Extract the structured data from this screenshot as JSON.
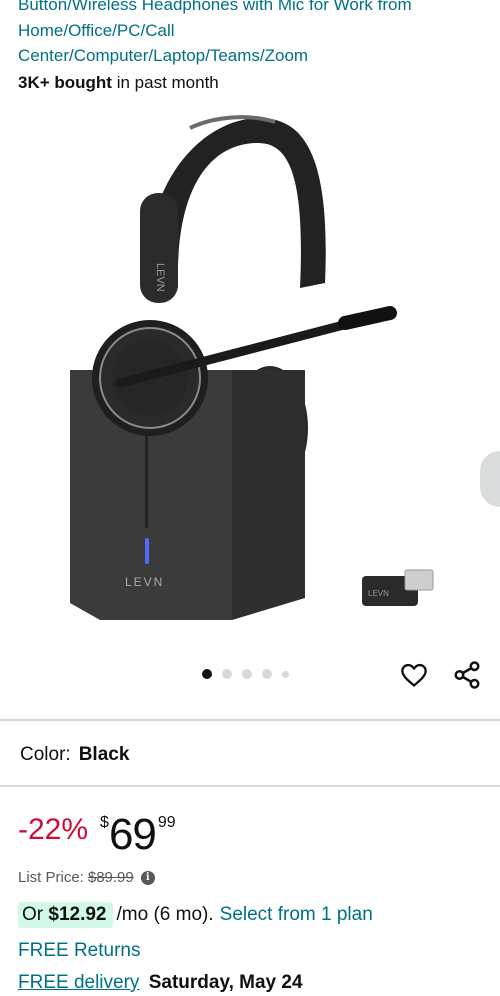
{
  "product": {
    "title_lines": [
      "Button/Wireless Headphones with Mic for Work from",
      "Home/Office/PC/Call",
      "Center/Computer/Laptop/Teams/Zoom"
    ],
    "bought_count": "3K+ bought",
    "bought_suffix": "in past month",
    "brand_mark": "LEVN",
    "image_description_icon": "headset-with-charging-stand-image"
  },
  "carousel": {
    "total_dots": 5,
    "active_index": 0
  },
  "color": {
    "label": "Color:",
    "value": "Black"
  },
  "price": {
    "discount": "-22%",
    "symbol": "$",
    "whole": "69",
    "fraction": "99",
    "list_label": "List Price:",
    "list_value": "$89.99",
    "info_glyph": "i"
  },
  "monthly": {
    "prefix": "Or",
    "amount": "$12.92",
    "suffix": "/mo (6 mo).",
    "plan_link": "Select from 1 plan"
  },
  "shipping": {
    "returns": "FREE Returns",
    "delivery_link": "FREE delivery",
    "delivery_date": "Saturday, May 24"
  },
  "colors": {
    "link": "#007185",
    "discount": "#cc0c39",
    "monthly_highlight": "#d2f8e6",
    "divider": "#d5d9d9"
  }
}
